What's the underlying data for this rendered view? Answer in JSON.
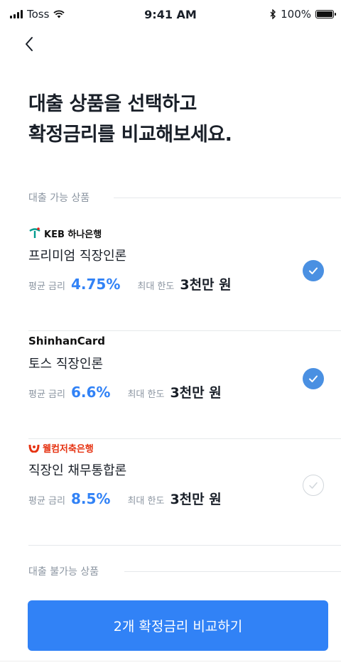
{
  "status_bar": {
    "carrier": "Toss",
    "time": "9:41 AM",
    "battery": "100%"
  },
  "title_line1": "대출 상품을 선택하고",
  "title_line2": "확정금리를 비교해보세요.",
  "available_section": "대출 가능 상품",
  "unavailable_section": "대출 불가능 상품",
  "rate_label": "평균 금리",
  "limit_label": "최대 한도",
  "products": [
    {
      "bank": "KEB 하나은행",
      "name": "프리미엄 직장인론",
      "rate": "4.75%",
      "limit": "3천만 원",
      "selected": true
    },
    {
      "bank": "ShinhanCard",
      "name": "토스 직장인론",
      "rate": "6.6%",
      "limit": "3천만 원",
      "selected": true
    },
    {
      "bank": "웰컴저축은행",
      "name": "직장인 채무통합론",
      "rate": "8.5%",
      "limit": "3천만 원",
      "selected": false
    }
  ],
  "cta_label": "2개 확정금리 비교하기",
  "colors": {
    "accent": "#3182f6",
    "check": "#4a90e2",
    "hana": "#009b8f",
    "welcome": "#e63312"
  }
}
